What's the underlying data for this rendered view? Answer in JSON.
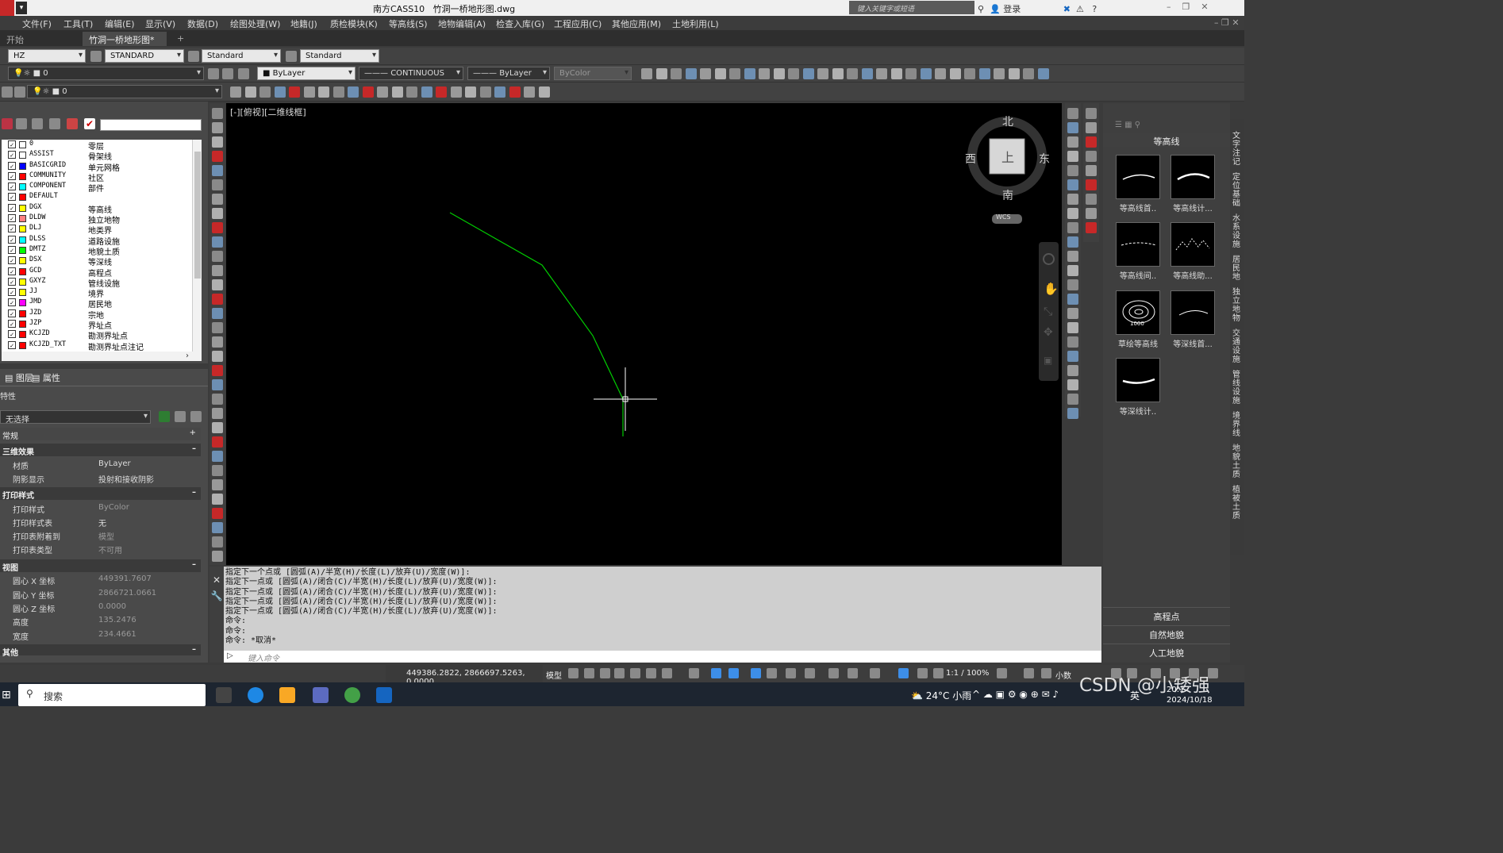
{
  "app": {
    "title": "南方CASS10",
    "file": "竹洞一桥地形图.dwg"
  },
  "search": {
    "placeholder": "键入关键字或短语"
  },
  "account": {
    "login": "登录"
  },
  "menu": [
    "文件(F)",
    "工具(T)",
    "编辑(E)",
    "显示(V)",
    "数据(D)",
    "绘图处理(W)",
    "地籍(J)",
    "质检模块(K)",
    "等高线(S)",
    "地物编辑(A)",
    "检查入库(G)",
    "工程应用(C)",
    "其他应用(M)",
    "土地利用(L)"
  ],
  "tabs": {
    "start": "开始",
    "doc": "竹洞一桥地形图*",
    "add": "+"
  },
  "toolbar1": {
    "hz": "HZ",
    "textstyle": "STANDARD",
    "dimstyle": "Standard",
    "tablestyle": "Standard"
  },
  "toolbar2": {
    "layer": "0",
    "color": "ByLayer",
    "linetype": "CONTINUOUS",
    "lineweight": "ByLayer",
    "plotstyle": "ByColor"
  },
  "toolbar3": {
    "layer": "0"
  },
  "layers": [
    {
      "name": "0",
      "desc": "零层",
      "color": "#ffffff"
    },
    {
      "name": "ASSIST",
      "desc": "骨架线",
      "color": "#ffffff"
    },
    {
      "name": "BASICGRID",
      "desc": "单元网格",
      "color": "#0000ff"
    },
    {
      "name": "COMMUNITY",
      "desc": "社区",
      "color": "#ff0000"
    },
    {
      "name": "COMPONENT",
      "desc": "部件",
      "color": "#00ffff"
    },
    {
      "name": "DEFAULT",
      "desc": "",
      "color": "#ff0000"
    },
    {
      "name": "DGX",
      "desc": "等高线",
      "color": "#ffff00"
    },
    {
      "name": "DLDW",
      "desc": "独立地物",
      "color": "#ff8080"
    },
    {
      "name": "DLJ",
      "desc": "地类界",
      "color": "#ffff00"
    },
    {
      "name": "DLSS",
      "desc": "道路设施",
      "color": "#00ffff"
    },
    {
      "name": "DMTZ",
      "desc": "地貌土质",
      "color": "#00ff00"
    },
    {
      "name": "DSX",
      "desc": "等深线",
      "color": "#ffff00"
    },
    {
      "name": "GCD",
      "desc": "高程点",
      "color": "#ff0000"
    },
    {
      "name": "GXYZ",
      "desc": "管线设施",
      "color": "#ffff00"
    },
    {
      "name": "JJ",
      "desc": "境界",
      "color": "#ffff00"
    },
    {
      "name": "JMD",
      "desc": "居民地",
      "color": "#ff00ff"
    },
    {
      "name": "JZD",
      "desc": "宗地",
      "color": "#ff0000"
    },
    {
      "name": "JZP",
      "desc": "界址点",
      "color": "#ff0000"
    },
    {
      "name": "KCJZD",
      "desc": "勘测界址点",
      "color": "#ff0000"
    },
    {
      "name": "KCJZD_TXT",
      "desc": "勘测界址点注记",
      "color": "#ff0000"
    }
  ],
  "panelTabs": {
    "layer": "图层",
    "props": "属性"
  },
  "props": {
    "header": "特性",
    "selection": "无选择",
    "general": "常规",
    "threeD": "三维效果",
    "material_k": "材质",
    "material_v": "ByLayer",
    "shadow_k": "阴影显示",
    "shadow_v": "投射和接收阴影",
    "print": "打印样式",
    "ps_k": "打印样式",
    "ps_v": "ByColor",
    "pst_k": "打印样式表",
    "pst_v": "无",
    "psa_k": "打印表附着到",
    "psa_v": "模型",
    "pstype_k": "打印表类型",
    "pstype_v": "不可用",
    "view": "视图",
    "cx_k": "圆心 X 坐标",
    "cx_v": "449391.7607",
    "cy_k": "圆心 Y 坐标",
    "cy_v": "2866721.0661",
    "cz_k": "圆心 Z 坐标",
    "cz_v": "0.0000",
    "h_k": "高度",
    "h_v": "135.2476",
    "w_k": "宽度",
    "w_v": "234.4661",
    "other": "其他"
  },
  "viewport": {
    "label": "[-][俯视][二维线框]",
    "north": "北",
    "south": "南",
    "east": "东",
    "west": "西",
    "top": "上",
    "wcs": "WCS"
  },
  "command": {
    "lines": [
      "指定下一个点或 [圆弧(A)/半宽(H)/长度(L)/放弃(U)/宽度(W)]:",
      "指定下一点或 [圆弧(A)/闭合(C)/半宽(H)/长度(L)/放弃(U)/宽度(W)]:",
      "指定下一点或 [圆弧(A)/闭合(C)/半宽(H)/长度(L)/放弃(U)/宽度(W)]:",
      "指定下一点或 [圆弧(A)/闭合(C)/半宽(H)/长度(L)/放弃(U)/宽度(W)]:",
      "指定下一点或 [圆弧(A)/闭合(C)/半宽(H)/长度(L)/放弃(U)/宽度(W)]:",
      "命令:",
      "命令:",
      "命令: *取消*"
    ],
    "placeholder": "键入命令"
  },
  "palette": {
    "title": "等高线",
    "items": [
      "等高线首..",
      "等高线计...",
      "等高线间..",
      "等高线助...",
      "草绘等高线",
      "等深线首...",
      "等深线计.."
    ],
    "sketch_label": "1000",
    "buttons": [
      "高程点",
      "自然地貌",
      "人工地貌"
    ],
    "sidetabs": [
      "文字注记",
      "定位基础",
      "水系设施",
      "居民地",
      "独立地物",
      "交通设施",
      "管线设施",
      "境界线",
      "地貌土质",
      "植被土质"
    ]
  },
  "status": {
    "coords": "449386.2822, 2866697.5263, 0.0000",
    "model": "模型",
    "scale": "1:1 / 100%",
    "units": "小数"
  },
  "taskbar": {
    "search": "搜索",
    "weather": "24°C 小雨",
    "ime": "英",
    "time": "20:1",
    "date": "2024/10/18"
  },
  "watermark": "CSDN @小矮强",
  "drawing": {
    "polyline_color": "#00cc00"
  }
}
